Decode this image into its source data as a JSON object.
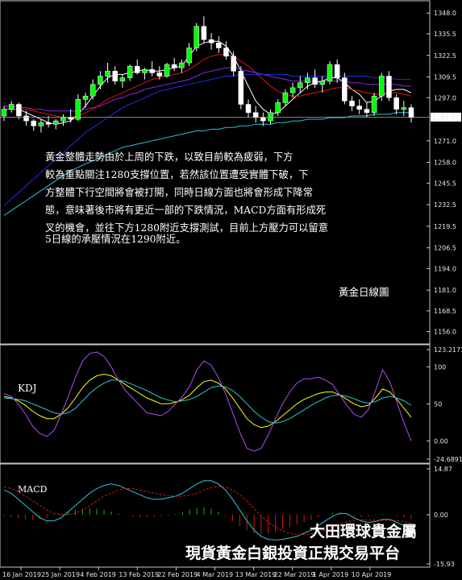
{
  "chart_data": [
    {
      "type": "candlestick",
      "title": "",
      "y_ticks": [
        "1348.0",
        "1335.5",
        "1322.5",
        "1309.5",
        "1297.0",
        "1271.0",
        "1258.0",
        "1245.5",
        "1232.5",
        "1219.5",
        "1206.5",
        "1194.0",
        "1181.0",
        "1168.5",
        "1156.0"
      ],
      "ylim": [
        1150,
        1352
      ],
      "last_price": "1285.3",
      "ohlc": [
        [
          1286,
          1292,
          1283,
          1290
        ],
        [
          1290,
          1295,
          1288,
          1293
        ],
        [
          1293,
          1294,
          1284,
          1286
        ],
        [
          1286,
          1289,
          1280,
          1283
        ],
        [
          1283,
          1284,
          1277,
          1280
        ],
        [
          1280,
          1284,
          1276,
          1282
        ],
        [
          1282,
          1286,
          1279,
          1281
        ],
        [
          1281,
          1284,
          1278,
          1283
        ],
        [
          1283,
          1287,
          1280,
          1285
        ],
        [
          1285,
          1290,
          1282,
          1284
        ],
        [
          1284,
          1299,
          1283,
          1296
        ],
        [
          1296,
          1300,
          1291,
          1298
        ],
        [
          1298,
          1308,
          1296,
          1305
        ],
        [
          1305,
          1313,
          1302,
          1310
        ],
        [
          1310,
          1318,
          1306,
          1313
        ],
        [
          1313,
          1316,
          1305,
          1307
        ],
        [
          1307,
          1311,
          1303,
          1309
        ],
        [
          1309,
          1317,
          1307,
          1316
        ],
        [
          1316,
          1320,
          1311,
          1312
        ],
        [
          1312,
          1315,
          1308,
          1314
        ],
        [
          1314,
          1319,
          1310,
          1312
        ],
        [
          1312,
          1316,
          1308,
          1310
        ],
        [
          1310,
          1318,
          1309,
          1317
        ],
        [
          1317,
          1321,
          1313,
          1315
        ],
        [
          1315,
          1320,
          1312,
          1318
        ],
        [
          1318,
          1330,
          1316,
          1327
        ],
        [
          1327,
          1342,
          1325,
          1340
        ],
        [
          1340,
          1346,
          1330,
          1332
        ],
        [
          1332,
          1336,
          1326,
          1330
        ],
        [
          1330,
          1334,
          1324,
          1327
        ],
        [
          1327,
          1331,
          1320,
          1322
        ],
        [
          1322,
          1325,
          1310,
          1313
        ],
        [
          1313,
          1316,
          1290,
          1293
        ],
        [
          1293,
          1296,
          1285,
          1288
        ],
        [
          1288,
          1292,
          1282,
          1285
        ],
        [
          1285,
          1288,
          1280,
          1283
        ],
        [
          1283,
          1290,
          1281,
          1288
        ],
        [
          1288,
          1296,
          1286,
          1294
        ],
        [
          1294,
          1302,
          1292,
          1300
        ],
        [
          1300,
          1306,
          1297,
          1303
        ],
        [
          1303,
          1310,
          1300,
          1306
        ],
        [
          1306,
          1312,
          1302,
          1309
        ],
        [
          1309,
          1314,
          1303,
          1305
        ],
        [
          1305,
          1310,
          1300,
          1307
        ],
        [
          1307,
          1319,
          1305,
          1317
        ],
        [
          1317,
          1320,
          1306,
          1309
        ],
        [
          1309,
          1312,
          1293,
          1295
        ],
        [
          1295,
          1298,
          1289,
          1292
        ],
        [
          1292,
          1296,
          1287,
          1290
        ],
        [
          1290,
          1294,
          1285,
          1288
        ],
        [
          1288,
          1300,
          1286,
          1298
        ],
        [
          1298,
          1312,
          1295,
          1310
        ],
        [
          1310,
          1313,
          1295,
          1297
        ],
        [
          1297,
          1299,
          1287,
          1290
        ],
        [
          1290,
          1295,
          1286,
          1291
        ],
        [
          1291,
          1293,
          1282,
          1285
        ]
      ],
      "series": [
        {
          "color": "#ffffff",
          "values": [
            1290,
            1290,
            1290,
            1288,
            1286,
            1284,
            1282,
            1281,
            1282,
            1283,
            1287,
            1292,
            1298,
            1304,
            1309,
            1311,
            1311,
            1312,
            1313,
            1314,
            1313,
            1313,
            1314,
            1315,
            1316,
            1322,
            1328,
            1330,
            1331,
            1331,
            1328,
            1322,
            1313,
            1304,
            1295,
            1290,
            1287,
            1288,
            1292,
            1296,
            1300,
            1304,
            1306,
            1307,
            1309,
            1309,
            1306,
            1302,
            1299,
            1294,
            1295,
            1298,
            1301,
            1302,
            1302,
            1300
          ]
        },
        {
          "color": "#e01414",
          "values": [
            1290,
            1290,
            1290,
            1290,
            1289,
            1288,
            1287,
            1286,
            1285,
            1285,
            1286,
            1288,
            1290,
            1293,
            1296,
            1298,
            1300,
            1302,
            1304,
            1306,
            1308,
            1309,
            1310,
            1311,
            1312,
            1314,
            1317,
            1320,
            1322,
            1323,
            1323,
            1322,
            1319,
            1316,
            1312,
            1308,
            1304,
            1301,
            1299,
            1298,
            1298,
            1299,
            1300,
            1301,
            1302,
            1303,
            1303,
            1302,
            1301,
            1300,
            1299,
            1299,
            1300,
            1300,
            1299,
            1298
          ]
        },
        {
          "color": "#8a2be2",
          "values": [
            1292,
            1292,
            1291,
            1291,
            1290,
            1290,
            1289,
            1289,
            1289,
            1289,
            1289,
            1290,
            1291,
            1292,
            1294,
            1296,
            1297,
            1299,
            1300,
            1302,
            1303,
            1304,
            1305,
            1306,
            1307,
            1308,
            1310,
            1312,
            1313,
            1314,
            1315,
            1315,
            1314,
            1313,
            1312,
            1311,
            1310,
            1309,
            1308,
            1307,
            1307,
            1307,
            1307,
            1307,
            1307,
            1307,
            1307,
            1306,
            1306,
            1305,
            1305,
            1305,
            1305,
            1305,
            1304,
            1304
          ]
        },
        {
          "color": "#1c2ee8",
          "values": [
            1232,
            1236,
            1240,
            1244,
            1248,
            1252,
            1256,
            1260,
            1264,
            1268,
            1272,
            1276,
            1279,
            1282,
            1285,
            1288,
            1291,
            1293,
            1295,
            1297,
            1299,
            1301,
            1302,
            1303,
            1304,
            1305,
            1306,
            1307,
            1308,
            1309,
            1310,
            1310,
            1311,
            1311,
            1311,
            1311,
            1311,
            1311,
            1311,
            1310,
            1310,
            1310,
            1310,
            1310,
            1310,
            1310,
            1310,
            1310,
            1310,
            1310,
            1309,
            1309,
            1309,
            1308,
            1308,
            1308
          ]
        },
        {
          "color": "#27c3d9",
          "values": [
            1226,
            1229,
            1232,
            1235,
            1238,
            1241,
            1244,
            1247,
            1250,
            1253,
            1255,
            1257,
            1259,
            1261,
            1263,
            1265,
            1267,
            1268,
            1269,
            1270,
            1271,
            1272,
            1273,
            1274,
            1275,
            1276,
            1277,
            1277,
            1278,
            1278,
            1279,
            1279,
            1280,
            1280,
            1281,
            1281,
            1281,
            1282,
            1282,
            1283,
            1283,
            1284,
            1284,
            1284,
            1285,
            1285,
            1285,
            1286,
            1286,
            1286,
            1287,
            1287,
            1287,
            1288,
            1288,
            1288
          ]
        }
      ]
    },
    {
      "type": "line",
      "title": "KDJ",
      "y_ticks": [
        "123.2171",
        "100",
        "50",
        "0.00",
        "-24.6891"
      ],
      "ylim": [
        -24.6891,
        123.2171
      ],
      "series": [
        {
          "name": "K",
          "color": "#ffff00",
          "values": [
            60,
            58,
            54,
            48,
            40,
            34,
            30,
            30,
            36,
            45,
            58,
            72,
            82,
            88,
            90,
            88,
            82,
            76,
            70,
            64,
            58,
            54,
            50,
            50,
            52,
            56,
            62,
            72,
            80,
            82,
            78,
            70,
            58,
            44,
            30,
            22,
            18,
            20,
            26,
            34,
            42,
            50,
            56,
            60,
            64,
            66,
            66,
            62,
            56,
            50,
            46,
            48,
            58,
            70,
            66,
            56,
            44,
            32
          ]
        },
        {
          "name": "D",
          "color": "#28c8d8",
          "values": [
            58,
            57,
            56,
            54,
            50,
            46,
            42,
            38,
            36,
            38,
            44,
            54,
            64,
            72,
            78,
            82,
            82,
            80,
            76,
            72,
            68,
            63,
            58,
            55,
            53,
            54,
            56,
            60,
            66,
            72,
            74,
            73,
            68,
            60,
            50,
            40,
            32,
            26,
            24,
            26,
            30,
            36,
            42,
            48,
            53,
            58,
            61,
            62,
            60,
            57,
            53,
            51,
            53,
            58,
            60,
            58,
            54,
            48
          ]
        },
        {
          "name": "J",
          "color": "#b44bf0",
          "values": [
            64,
            60,
            50,
            36,
            20,
            10,
            6,
            14,
            36,
            60,
            86,
            108,
            118,
            120,
            114,
            100,
            82,
            68,
            58,
            48,
            38,
            36,
            34,
            40,
            50,
            60,
            74,
            96,
            108,
            102,
            86,
            64,
            38,
            12,
            -10,
            -14,
            -10,
            8,
            30,
            50,
            66,
            78,
            84,
            84,
            86,
            82,
            76,
            62,
            48,
            36,
            32,
            42,
            68,
            96,
            80,
            52,
            24,
            0
          ]
        }
      ]
    },
    {
      "type": "bar+line",
      "title": "MACD",
      "y_ticks": [
        "14.87",
        "0.00",
        "-15.93"
      ],
      "ylim": [
        -15.93,
        14.87
      ],
      "histogram": [
        -0.5,
        -0.8,
        -1.2,
        -1.5,
        -1.6,
        -1.4,
        -1,
        -0.4,
        0.3,
        1,
        1.6,
        2,
        2.2,
        2,
        1.6,
        1,
        0.4,
        -0.2,
        -0.6,
        -0.8,
        -0.8,
        -0.6,
        -0.4,
        -0.2,
        0.2,
        0.8,
        1.6,
        2.2,
        2.4,
        2,
        1,
        -0.4,
        -2,
        -3.6,
        -5,
        -6,
        -6.4,
        -6.2,
        -5.6,
        -4.8,
        -4,
        -3.2,
        -2.4,
        -1.6,
        -0.8,
        0,
        0.6,
        0.4,
        -0.2,
        -0.6,
        -0.8,
        -0.6,
        -0.2,
        0.2,
        0,
        -0.4,
        -0.8,
        -1.4
      ],
      "series": [
        {
          "name": "MACD",
          "color": "#28c8d8",
          "values": [
            8,
            7,
            5,
            3,
            1,
            -1,
            -2,
            -2,
            -1,
            1,
            3,
            5,
            7,
            8.5,
            9.5,
            10,
            9.5,
            8.5,
            7.5,
            6.5,
            5.5,
            5,
            5,
            5.5,
            6,
            7,
            8.5,
            10,
            11,
            11,
            10,
            8,
            5,
            1.5,
            -2,
            -5,
            -7,
            -8,
            -8.2,
            -8,
            -7.5,
            -7,
            -6,
            -5,
            -3.5,
            -2,
            -0.5,
            0.5,
            0.3,
            -1,
            -2,
            -2.5,
            -2.2,
            -1.5,
            -1.5,
            -2.5,
            -3.5,
            -5
          ]
        },
        {
          "name": "Signal",
          "color": "#e01414",
          "values": [
            9,
            8.5,
            7.5,
            6,
            4.5,
            3,
            1.5,
            0.5,
            0,
            0,
            0.5,
            1.5,
            3,
            4.5,
            6,
            7,
            8,
            8.5,
            8.5,
            8,
            7.5,
            7,
            6.5,
            6.2,
            6,
            6,
            6.4,
            7,
            8,
            8.8,
            9.2,
            9,
            8,
            6.5,
            4.5,
            2,
            -0.5,
            -2.5,
            -4,
            -5.2,
            -6,
            -6.4,
            -6.5,
            -6.2,
            -5.8,
            -5,
            -4,
            -3,
            -2.3,
            -1.8,
            -1.6,
            -1.7,
            -1.8,
            -1.8,
            -1.8,
            -1.9,
            -2.2,
            -2.8
          ]
        }
      ]
    }
  ],
  "x_ticks": [
    "16 Jan 2019",
    "25 Jan 2019",
    "4 Feb 2019",
    "13 Feb 2019",
    "22 Feb 2019",
    "4 Mar 2019",
    "13 Mar 2019",
    "22 Mar 2019",
    "1 Apr 2019",
    "10 Apr 2019"
  ],
  "annotation": {
    "lines": [
      "黃金整體走勢由於上周的下跌，以致目前較為疲弱，下方",
      "較為重點關注1280支撐位置，若然該位置遭受實體下破，下",
      "方整體下行空間將會被打開，同時日線方面也將會形成下降常",
      "態，意味著後市將有更近一部的下跌情況，MACD方面有形成死",
      "叉的機會，並往下方1280附近支撐測試，目前上方壓力可以留意",
      "5日線的承壓情況在1290附近。"
    ],
    "caption": "黃金日線圖"
  },
  "watermark": {
    "line1": "大田環球貴金屬",
    "line2": "現貨黃金白銀投資正規交易平台"
  }
}
